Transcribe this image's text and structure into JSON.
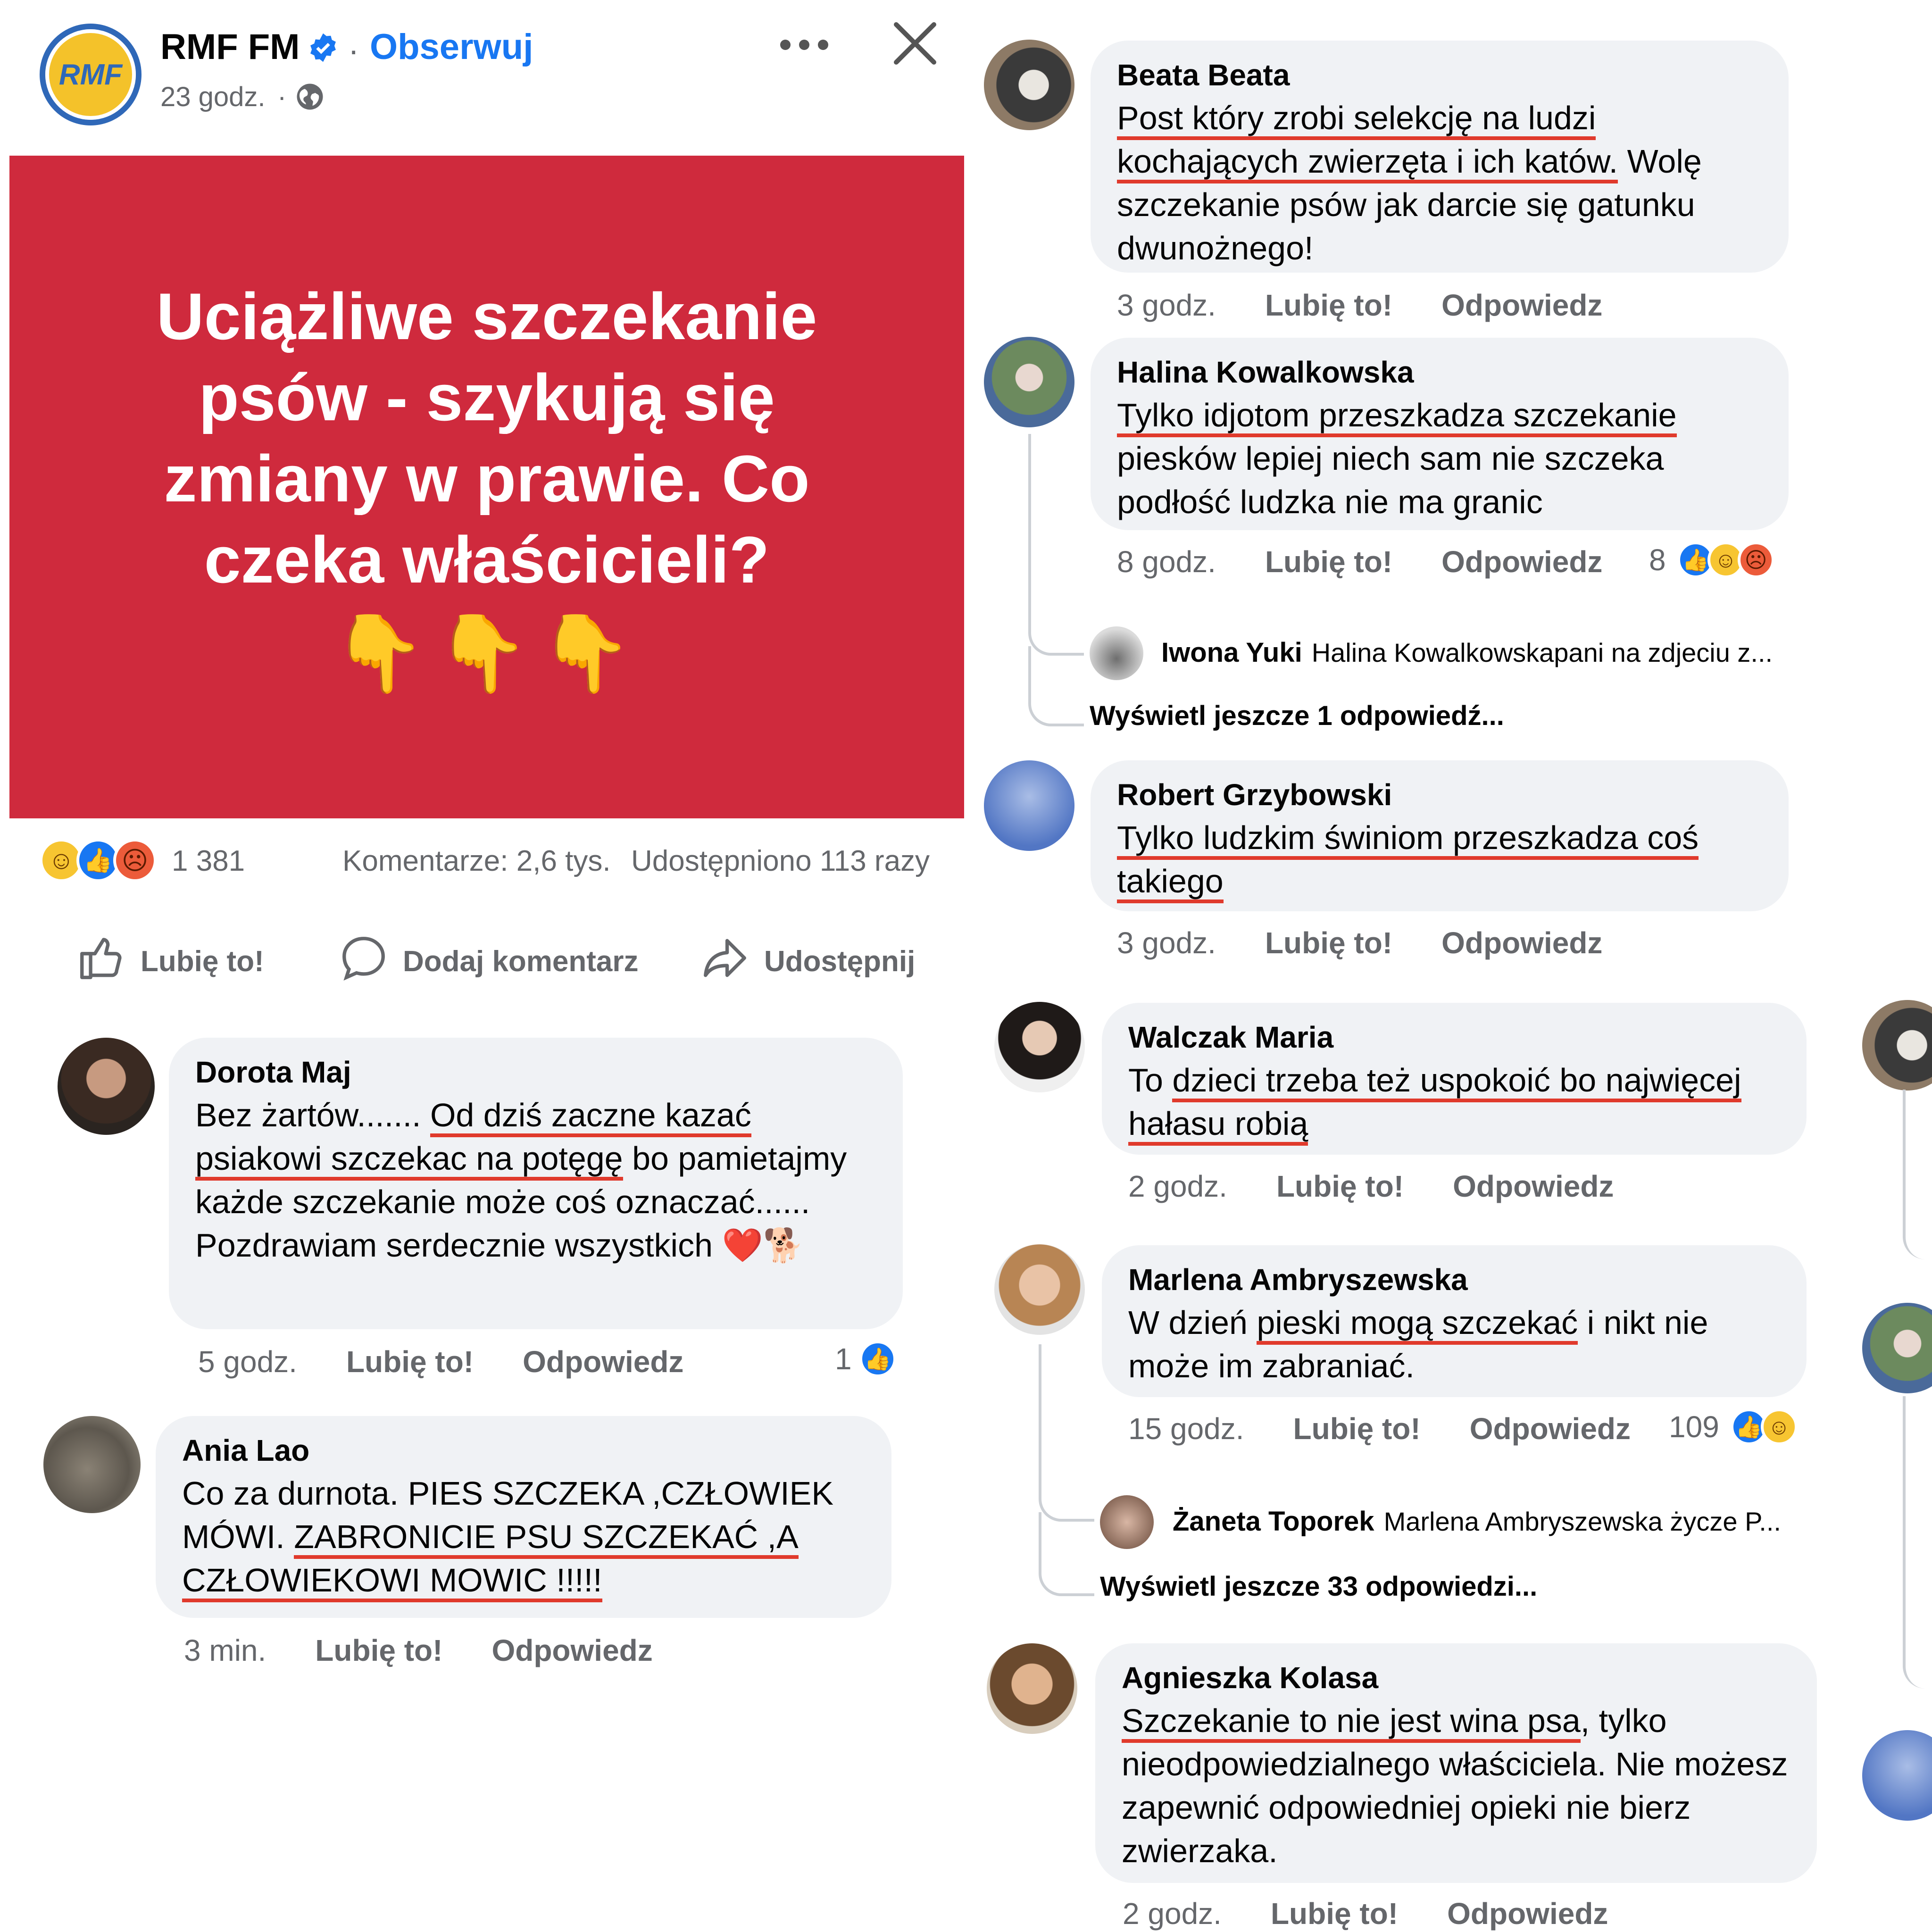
{
  "post": {
    "page_name": "RMF FM",
    "separator": "·",
    "follow_label": "Obserwuj",
    "time": "23 godz.",
    "logo_text": "RMF",
    "image_title": "Uciążliwe szczekanie psów - szykują się zmiany w prawie. Co czeka właścicieli?",
    "image_emoji": "👇👇👇",
    "reaction_count": "1 381",
    "comments_count": "Komentarze: 2,6 tys.",
    "shares_count": "Udostępniono 113 razy",
    "actions": {
      "like": "Lubię to!",
      "comment": "Dodaj komentarz",
      "share": "Udostępnij"
    }
  },
  "accent_color": "#1877f2",
  "hero_color": "#cf2a3d",
  "underline_color": "#e03a2c",
  "left_comments": [
    {
      "name": "Dorota Maj",
      "text_parts": [
        {
          "t": "Bez żartów....... ",
          "u": false
        },
        {
          "t": "Od dziś zaczne kazać psiakowi szczekac na potęgę",
          "u": true
        },
        {
          "t": " bo pamietajmy każde szczekanie może coś oznaczać...... Pozdrawiam serdecznie wszystkich ❤️🐕",
          "u": false
        }
      ],
      "time": "5 godz.",
      "like": "Lubię to!",
      "reply": "Odpowiedz",
      "reaction_count": "1"
    },
    {
      "name": "Ania Lao",
      "text_parts": [
        {
          "t": "Co za durnota. PIES  SZCZEKA ,CZŁOWIEK MÓWI. ",
          "u": false
        },
        {
          "t": "ZABRONICIE PSU SZCZEKAĆ ,A CZŁOWIEKOWI MOWIC !!!!!",
          "u": true
        }
      ],
      "time": "3 min.",
      "like": "Lubię to!",
      "reply": "Odpowiedz"
    }
  ],
  "right_comments": [
    {
      "name": "Beata Beata",
      "text_parts": [
        {
          "t": "Post który zrobi selekcję na ludzi kochających zwierzęta i ich katów.",
          "u": true
        },
        {
          "t": " Wolę szczekanie psów jak darcie się gatunku dwunożnego!",
          "u": false
        }
      ],
      "time": "3 godz.",
      "like": "Lubię to!",
      "reply": "Odpowiedz"
    },
    {
      "name": "Halina Kowalkowska",
      "text_parts": [
        {
          "t": "Tylko idjotom przeszkadza szczekanie",
          "u": true
        },
        {
          "t": " piesków lepiej niech sam nie szczeka podłość ludzka nie ma granic",
          "u": false
        }
      ],
      "time": "8 godz.",
      "like": "Lubię to!",
      "reply": "Odpowiedz",
      "reaction_count": "8",
      "reply_name": "Iwona Yuki",
      "reply_text": "Halina Kowalkowskapani na zdjeciu z...",
      "view_more": "Wyświetl jeszcze 1 odpowiedź..."
    },
    {
      "name": "Robert Grzybowski",
      "text_parts": [
        {
          "t": "Tylko ludzkim świniom przeszkadza coś takiego",
          "u": true
        }
      ],
      "time": "3 godz.",
      "like": "Lubię to!",
      "reply": "Odpowiedz"
    },
    {
      "name": "Walczak Maria",
      "text_parts": [
        {
          "t": "To ",
          "u": false
        },
        {
          "t": "dzieci trzeba też uspokoić bo najwięcej hałasu robią",
          "u": true
        }
      ],
      "time": "2 godz.",
      "like": "Lubię to!",
      "reply": "Odpowiedz"
    },
    {
      "name": "Marlena Ambryszewska",
      "text_parts": [
        {
          "t": "W dzień ",
          "u": false
        },
        {
          "t": "pieski mogą szczekać",
          "u": true
        },
        {
          "t": " i nikt nie może im zabraniać.",
          "u": false
        }
      ],
      "time": "15 godz.",
      "like": "Lubię to!",
      "reply": "Odpowiedz",
      "reaction_count": "109",
      "reply_name": "Żaneta Toporek",
      "reply_text": "Marlena Ambryszewska życze P...",
      "view_more": "Wyświetl jeszcze 33 odpowiedzi..."
    },
    {
      "name": "Agnieszka Kolasa",
      "text_parts": [
        {
          "t": "Szczekanie to nie jest wina psa",
          "u": true
        },
        {
          "t": ", tylko nieodpowiedzialnego właściciela. Nie możesz zapewnić odpowiedniej opieki nie bierz zwierzaka.",
          "u": false
        }
      ],
      "time": "2 godz.",
      "like": "Lubię to!",
      "reply": "Odpowiedz"
    }
  ]
}
